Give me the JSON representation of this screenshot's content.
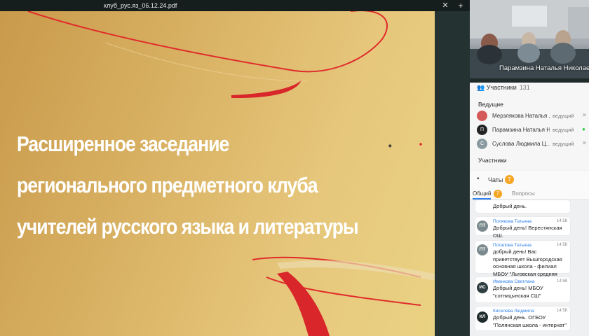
{
  "presentation": {
    "file_name": "клуб_рус.яз_06.12.24.pdf",
    "close_glyph": "✕",
    "add_glyph": "+",
    "slide_title_lines": [
      "Расширенное заседание",
      "регионального предметного клуба",
      "учителей русского языка и литературы"
    ],
    "colors": {
      "gold_dark": "#c99a4b",
      "gold_light": "#ead283",
      "ribbon_red": "#e02b2b"
    }
  },
  "video": {
    "speaker_name": "Парамзина Наталья Николаевна"
  },
  "participants": {
    "title": "Участники",
    "count": "131",
    "hosts_label": "Ведущие",
    "participants_label": "Участники",
    "hosts": [
      {
        "name": "Мерзлякова Наталья ...",
        "role": "ведущий",
        "avatar": "",
        "avatar_color": "#d45a5a"
      },
      {
        "name": "Парамзина Наталья Н...",
        "role": "ведущий",
        "avatar": "П",
        "avatar_color": "#222222"
      },
      {
        "name": "Суслова Людмила Ц...",
        "role": "ведущий",
        "avatar": "С",
        "avatar_color": "#8a9aa0"
      }
    ]
  },
  "chats": {
    "title": "Чаты",
    "badge": "7",
    "tab_all": "Общий",
    "tab_all_badge": "7",
    "tab_questions": "Вопросы",
    "messages": [
      {
        "author": "",
        "time": "",
        "text": "Добрый день.",
        "initials": "",
        "avatar_color": "#4a6fa5"
      },
      {
        "author": "Полякова Татьяна",
        "time": "14:58",
        "text": "Добрый день! Верестянская ОШ.",
        "initials": "ПТ",
        "avatar_color": "#7a8a8e"
      },
      {
        "author": "Потапова Татьяна",
        "time": "14:58",
        "text": "добрый день! Вас приветствует Вышгородская основная школа - филиал МБОУ \"Льговская средняя школа\"",
        "initials": "ПТ",
        "avatar_color": "#7a8a8e"
      },
      {
        "author": "Иванкова Светлана",
        "time": "14:58",
        "text": "Добрый день! МБОУ \"сотницынская СШ\"",
        "initials": "ИС",
        "avatar_color": "#2e3d40"
      },
      {
        "author": "Киселева Людмила",
        "time": "14:58",
        "text": "Добрый день. ОГБОУ \"Полянская школа - интернат\"",
        "initials": "КЛ",
        "avatar_color": "#1f2b2b"
      }
    ]
  }
}
